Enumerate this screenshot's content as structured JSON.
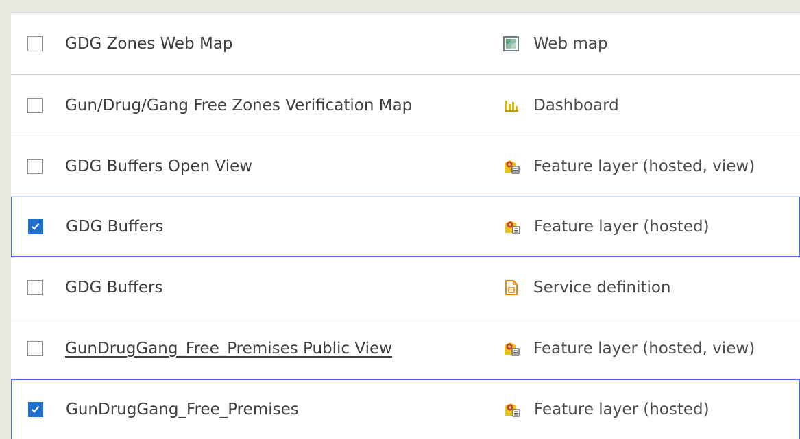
{
  "items": [
    {
      "title": "GDG Zones Web Map",
      "type": "Web map",
      "checked": false,
      "icon": "web-map-icon"
    },
    {
      "title": "Gun/Drug/Gang Free Zones Verification Map",
      "type": "Dashboard",
      "checked": false,
      "icon": "dashboard-icon"
    },
    {
      "title": "GDG Buffers Open View",
      "type": "Feature layer (hosted, view)",
      "checked": false,
      "icon": "feature-layer-icon"
    },
    {
      "title": "GDG Buffers",
      "type": "Feature layer (hosted)",
      "checked": true,
      "icon": "feature-layer-icon"
    },
    {
      "title": "GDG Buffers",
      "type": "Service definition",
      "checked": false,
      "icon": "service-definition-icon"
    },
    {
      "title": "GunDrugGang_Free_Premises Public View",
      "type": "Feature layer (hosted, view)",
      "checked": false,
      "icon": "feature-layer-icon"
    },
    {
      "title": "GunDrugGang_Free_Premises",
      "type": "Feature layer (hosted)",
      "checked": true,
      "icon": "feature-layer-icon"
    }
  ],
  "colors": {
    "selected_border": "#4d6fd6",
    "checkbox_checked": "#1f6fd0",
    "dashboard_icon": "#e5b800",
    "feature_layer_icon": "#e9c21a",
    "service_definition_icon": "#e48a12"
  }
}
